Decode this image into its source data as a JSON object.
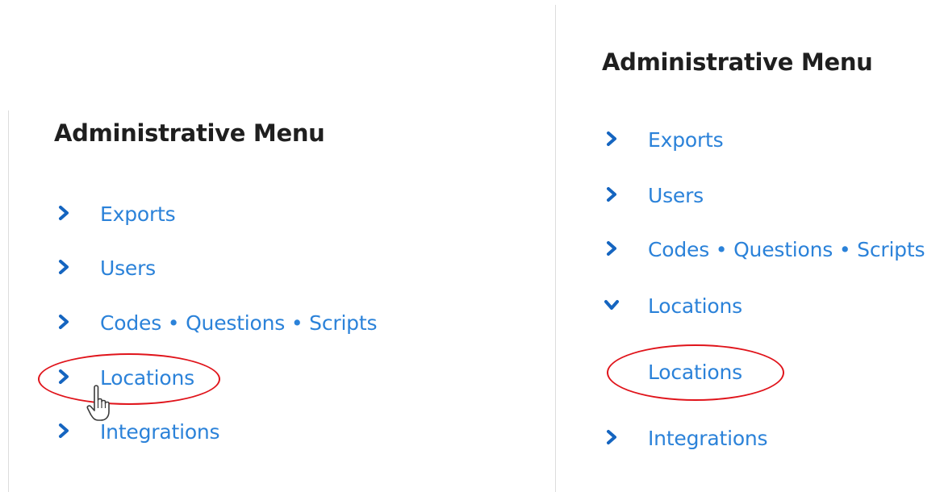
{
  "left_panel": {
    "heading": "Administrative Menu",
    "items": [
      {
        "label": "Exports",
        "icon": "chevron-right-icon"
      },
      {
        "label": "Users",
        "icon": "chevron-right-icon"
      },
      {
        "label": "Codes • Questions • Scripts",
        "icon": "chevron-right-icon"
      },
      {
        "label": "Locations",
        "icon": "chevron-right-icon"
      },
      {
        "label": "Integrations",
        "icon": "chevron-right-icon"
      }
    ],
    "highlighted_item": "Locations",
    "cursor": "hand-pointer-icon"
  },
  "right_panel": {
    "heading": "Administrative Menu",
    "items": [
      {
        "label": "Exports",
        "icon": "chevron-right-icon"
      },
      {
        "label": "Users",
        "icon": "chevron-right-icon"
      },
      {
        "label": "Codes • Questions • Scripts",
        "icon": "chevron-right-icon"
      },
      {
        "label": "Locations",
        "icon": "chevron-down-icon",
        "expanded": true
      },
      {
        "label": "Integrations",
        "icon": "chevron-right-icon"
      }
    ],
    "sub_items": [
      {
        "label": "Locations"
      }
    ],
    "highlighted_item": "Locations"
  },
  "colors": {
    "link": "#2b82d9",
    "chevron": "#1565c0",
    "heading": "#1f1f1f",
    "highlight": "#e0141b",
    "divider": "#dcdcdc"
  }
}
